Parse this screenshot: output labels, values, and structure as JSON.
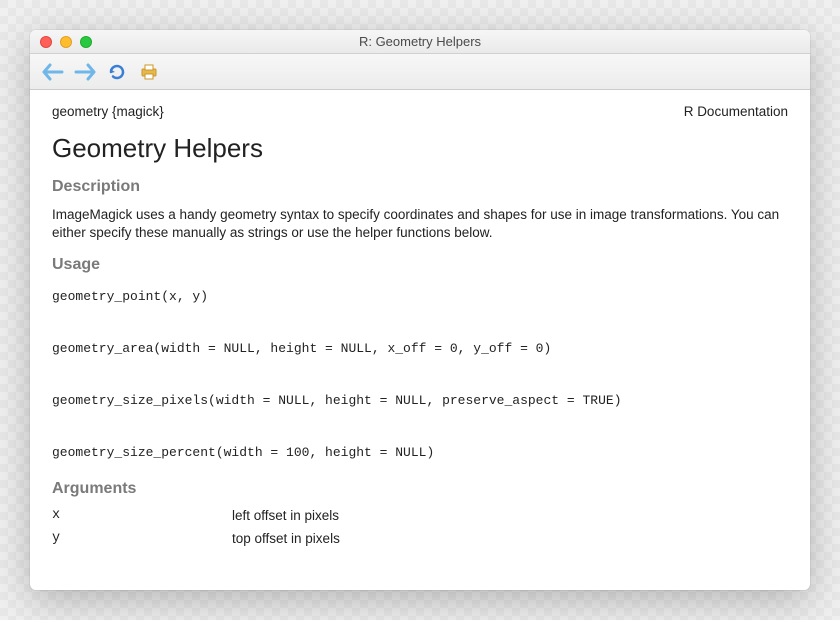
{
  "window": {
    "title": "R: Geometry Helpers"
  },
  "header": {
    "left": "geometry {magick}",
    "right": "R Documentation"
  },
  "page": {
    "title": "Geometry Helpers",
    "section_description_label": "Description",
    "description": "ImageMagick uses a handy geometry syntax to specify coordinates and shapes for use in image transformations. You can either specify these manually as strings or use the helper functions below.",
    "section_usage_label": "Usage",
    "usage_code": "geometry_point(x, y)\n\ngeometry_area(width = NULL, height = NULL, x_off = 0, y_off = 0)\n\ngeometry_size_pixels(width = NULL, height = NULL, preserve_aspect = TRUE)\n\ngeometry_size_percent(width = 100, height = NULL)",
    "section_arguments_label": "Arguments",
    "arguments": [
      {
        "name": "x",
        "desc": "left offset in pixels"
      },
      {
        "name": "y",
        "desc": "top offset in pixels"
      }
    ]
  }
}
